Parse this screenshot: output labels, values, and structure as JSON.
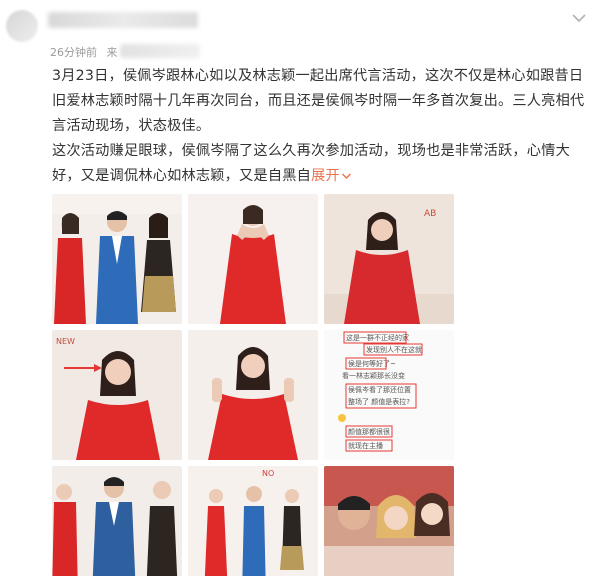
{
  "post": {
    "time": "26分钟前",
    "source_prefix": "来",
    "paragraphs": [
      "3月23日，侯佩岑跟林心如以及林志颖一起出席代言活动，这次不仅是林心如跟昔日旧爱林志颖时隔十几年再次同台，而且还是侯佩岑时隔一年多首次复出。三人亮相代言活动现场，状态极佳。",
      "这次活动赚足眼球，侯佩岑隔了这么久再次参加活动，现场也是非常活跃，心情大好，又是调侃林心如林志颖，又是自黑自"
    ],
    "expand_label": "展开",
    "expand_icon": "chevron-down-icon"
  },
  "photos": [
    {
      "name": "photo-event-trio",
      "kind": "trio"
    },
    {
      "name": "photo-heart-pose",
      "kind": "heart"
    },
    {
      "name": "photo-smiling-red-dress",
      "kind": "smile"
    },
    {
      "name": "photo-arrow-closeup",
      "kind": "arrow"
    },
    {
      "name": "photo-peace-sign",
      "kind": "peace"
    },
    {
      "name": "photo-chat-screenshot",
      "kind": "chat"
    },
    {
      "name": "photo-event-trio-2",
      "kind": "trio2"
    },
    {
      "name": "photo-stage-lineup",
      "kind": "lineup"
    },
    {
      "name": "photo-group-closeup",
      "kind": "group"
    }
  ],
  "chat_lines": [
    "这是一群不正经的家",
    "发现别人不在这就",
    "侯是何等好了~",
    "看一林志颖那长没变",
    "侯佩岑看了那还位置",
    "整场了 颜值是表拉?",
    "颜值那都很很",
    "就现在主播"
  ],
  "colors": {
    "accent": "#eb7350",
    "dress_red": "#e02a2a",
    "suit_blue": "#2e6bb8",
    "stage_bg": "#f3e7e2",
    "chat_highlight": "#e53935"
  }
}
